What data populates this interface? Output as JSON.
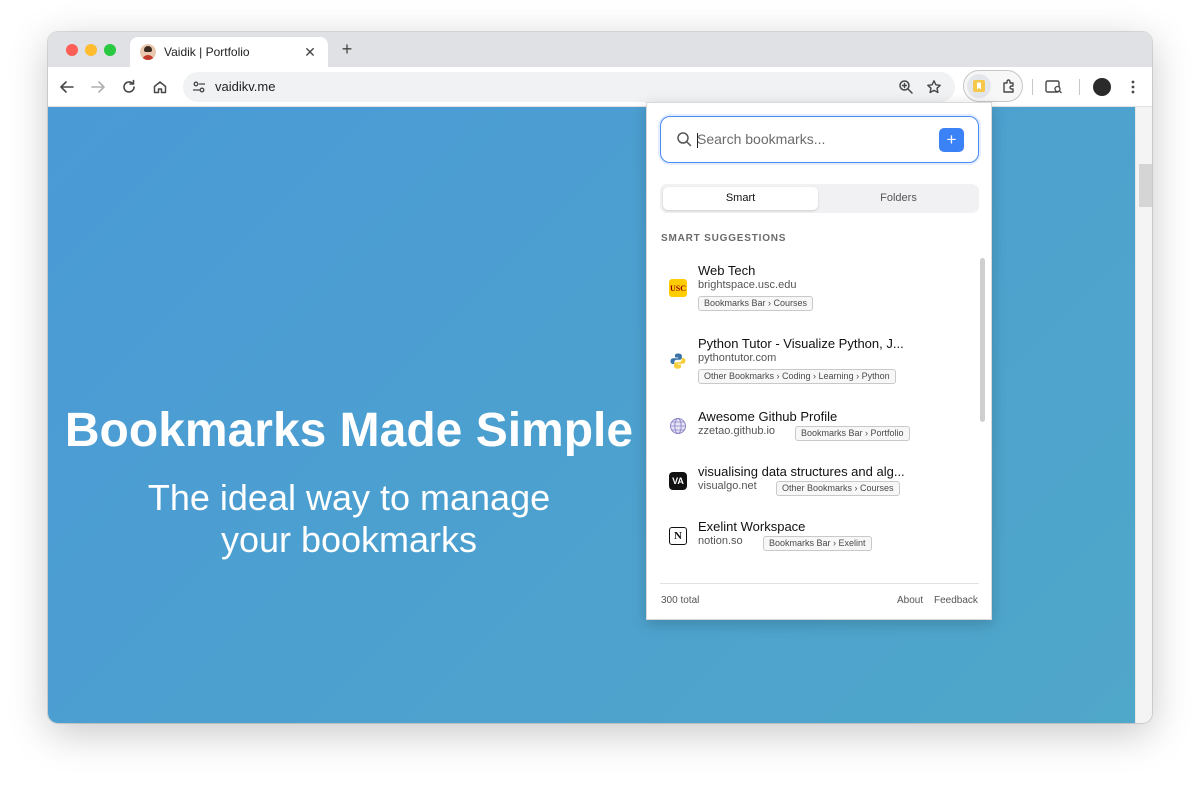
{
  "browser": {
    "tab_title": "Vaidik | Portfolio",
    "tab_close_glyph": "✕",
    "new_tab_glyph": "+",
    "url": "vaidikv.me"
  },
  "hero": {
    "title": "Bookmarks Made Simple",
    "subtitle": "The ideal way to manage your bookmarks"
  },
  "popup": {
    "search_placeholder": "Search bookmarks...",
    "add_glyph": "+",
    "tabs": [
      {
        "label": "Smart",
        "active": true
      },
      {
        "label": "Folders",
        "active": false
      }
    ],
    "section_label": "SMART SUGGESTIONS",
    "items": [
      {
        "title": "Web Tech",
        "domain": "brightspace.usc.edu",
        "path": "Bookmarks Bar › Courses",
        "icon": "usc-icon",
        "icon_text": "USC"
      },
      {
        "title": "Python Tutor - Visualize Python, J...",
        "domain": "pythontutor.com",
        "path": "Other Bookmarks › Coding › Learning › Python",
        "icon": "python-icon",
        "icon_text": ""
      },
      {
        "title": "Awesome Github Profile",
        "domain": "zzetao.github.io",
        "path": "Bookmarks Bar › Portfolio",
        "icon": "globe-icon",
        "icon_text": ""
      },
      {
        "title": "visualising data structures and alg...",
        "domain": "visualgo.net",
        "path": "Other Bookmarks › Courses",
        "icon": "visualgo-icon",
        "icon_text": "VA"
      },
      {
        "title": "Exelint Workspace",
        "domain": "notion.so",
        "path": "Bookmarks Bar › Exelint",
        "icon": "notion-icon",
        "icon_text": "N"
      }
    ],
    "footer": {
      "total": "300 total",
      "about": "About",
      "feedback": "Feedback"
    }
  },
  "colors": {
    "accent": "#3b82f6",
    "hero_bg_start": "#4a9ad6",
    "hero_bg_end": "#4fa7c9"
  }
}
